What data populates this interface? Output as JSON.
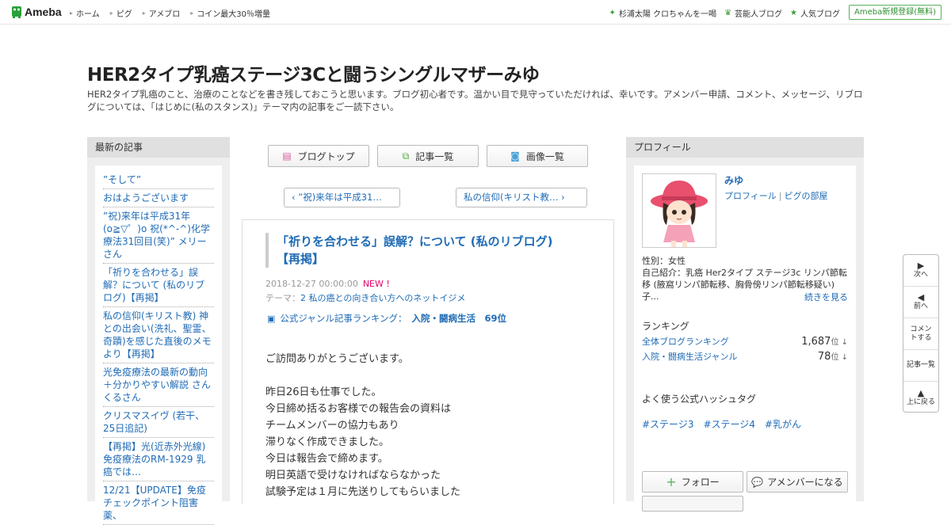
{
  "header": {
    "logo": "Ameba",
    "nav": [
      "ホーム",
      "ピグ",
      "アメブロ",
      "コイン最大30％増量"
    ],
    "right_links": [
      {
        "label": "杉浦太陽 クロちゃんを一喝",
        "icon": "sparkle-icon"
      },
      {
        "label": "芸能人ブログ",
        "icon": "crown-icon"
      },
      {
        "label": "人気ブログ",
        "icon": "star-icon"
      }
    ],
    "signup": "Ameba新規登録(無料)"
  },
  "blog": {
    "title": "HER2タイプ乳癌ステージ3Cと闘うシングルマザーみゆ",
    "description": "HER2タイプ乳癌のこと、治療のことなどを書き残しておこうと思います。ブログ初心者です。温かい目で見守っていただければ、幸いです。アメンバー申請、コメント、メッセージ、リブログについては、「はじめに(私のスタンス)」テーマ内の記事をご一読下さい。"
  },
  "left": {
    "heading": "最新の記事",
    "entries": [
      "”そして”",
      "おはようございます",
      "”祝)来年は平成31年(o≧▽゜)o 祝(*^-^)化学療法31回目(笑)” メリーさん",
      "「祈りを合わせる」誤解？について (私のリブログ)【再掲】",
      "私の信仰(キリスト教) 神との出会い(洗礼、聖霊、奇蹟)を感じた直後のメモより【再掲】",
      "光免疫療法の最新の動向＋分かりやすい解説 さんくるさん",
      "クリスマスイヴ (若干、25日追記)",
      "【再掲】光(近赤外光線)免疫療法のRM-1929 乳癌では…",
      "12/21【UPDATE】免疫チェックポイント阻害薬、"
    ]
  },
  "center": {
    "buttons": [
      {
        "label": "ブログトップ",
        "icon": "document-icon"
      },
      {
        "label": "記事一覧",
        "icon": "copy-icon"
      },
      {
        "label": "画像一覧",
        "icon": "camera-icon"
      }
    ],
    "prev": "”祝)来年は平成31…",
    "next": "私の信仰(キリスト教…",
    "article": {
      "title": "「祈りを合わせる」誤解？について (私のリブログ)【再掲】",
      "date": "2018-12-27 00:00:00",
      "new_badge": "NEW !",
      "theme_label": "テーマ：",
      "theme": "2 私の癌との向き合い方へのネットイジメ",
      "rank_label": "公式ジャンル記事ランキング：",
      "rank_value": "入院・闘病生活　69位",
      "body": [
        "ご訪問ありがとうございます。",
        "",
        "昨日26日も仕事でした。",
        "今日締め括るお客様での報告会の資料は",
        "チームメンバーの協力もあり",
        "滞りなく作成できました。",
        "今日は報告会で締めます。",
        "明日英語で受けなければならなかった",
        "試験予定は１月に先送りしてもらいました"
      ]
    }
  },
  "right": {
    "heading": "プロフィール",
    "name": "みゆ",
    "profile_link": "プロフィール",
    "pig_link": "ピグの部屋",
    "gender": "性別：女性",
    "intro": "自己紹介：乳癌 Her2タイプ ステージ3c リンパ節転移 (腋窩リンパ節転移、胸骨傍リンパ節転移疑い) 子...",
    "more": "続きを見る",
    "ranking_heading": "ランキング",
    "rankings": [
      {
        "label": "全体ブログランキング",
        "value": "1,687",
        "unit": "位 ↓"
      },
      {
        "label": "入院・闘病生活ジャンル",
        "value": "78",
        "unit": "位 ↓"
      }
    ],
    "hashtag_heading": "よく使う公式ハッシュタグ",
    "hashtags": [
      "#ステージ3",
      "#ステージ4",
      "#乳がん"
    ],
    "follow": "フォロー",
    "amember": "アメンバーになる"
  },
  "sidenav": [
    {
      "label": "次へ",
      "icon": "triangle-right-icon"
    },
    {
      "label": "前へ",
      "icon": "triangle-left-icon"
    },
    {
      "label": "コメントする",
      "icon": ""
    },
    {
      "label": "記事一覧",
      "icon": ""
    },
    {
      "label": "上に戻る",
      "icon": "triangle-up-icon"
    }
  ]
}
